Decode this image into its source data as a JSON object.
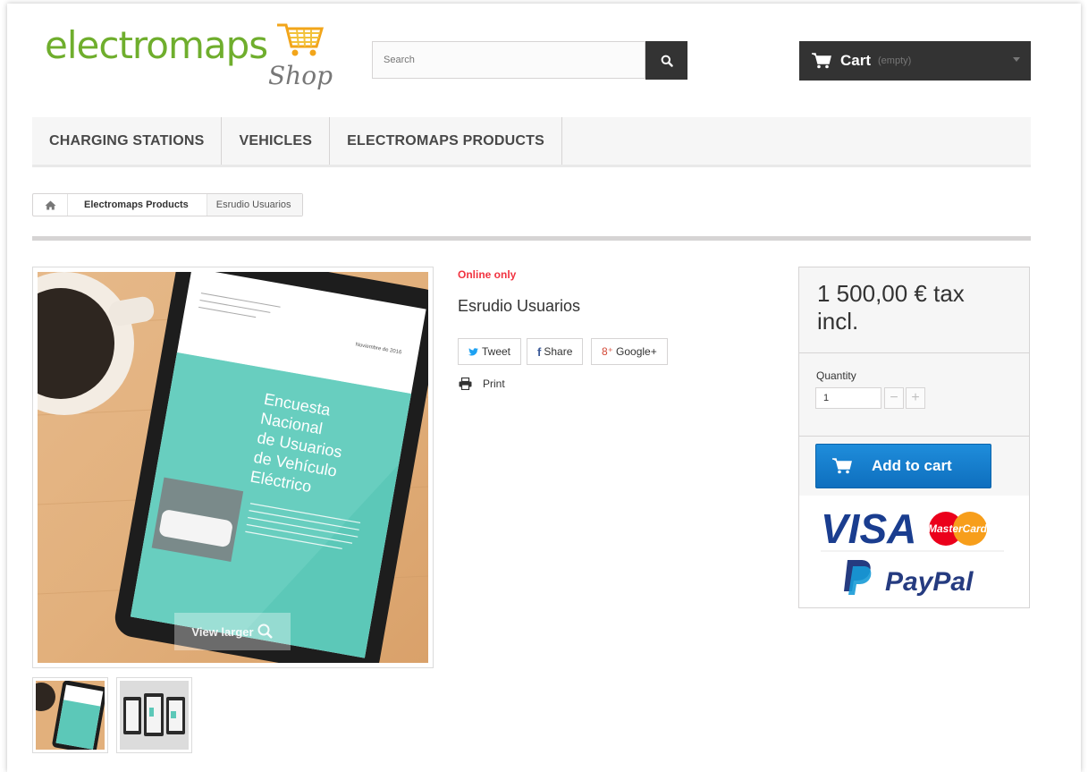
{
  "header": {
    "logo": {
      "word": "electromaps",
      "sub": "Shop"
    },
    "search": {
      "placeholder": "Search"
    },
    "cart": {
      "label": "Cart",
      "status": "(empty)"
    }
  },
  "menu": {
    "items": [
      {
        "label": "CHARGING STATIONS"
      },
      {
        "label": "VEHICLES"
      },
      {
        "label": "ELECTROMAPS PRODUCTS"
      }
    ]
  },
  "breadcrumb": {
    "category": "Electromaps Products",
    "current": "Esrudio Usuarios"
  },
  "product": {
    "badge": "Online only",
    "name": "Esrudio Usuarios",
    "view_larger": "View larger",
    "image_text": {
      "title_lines": [
        "Encuesta",
        "Nacional",
        "de Usuarios",
        "de Vehículo",
        "Eléctrico"
      ],
      "date": "Noviembre de 2016"
    },
    "share": {
      "tweet": "Tweet",
      "share": "Share",
      "google": "Google+"
    },
    "print": "Print"
  },
  "buy_box": {
    "price": "1 500,00 € tax incl.",
    "quantity_label": "Quantity",
    "quantity_value": "1",
    "add_to_cart": "Add to cart",
    "payment": {
      "visa": "VISA",
      "mastercard": "MasterCard",
      "paypal": "PayPal"
    }
  },
  "colors": {
    "brand_green": "#6fae2d",
    "dark": "#333333",
    "accent_blue": "#0f7ad0",
    "alert_red": "#f13340",
    "teal": "#5cc8b8"
  }
}
